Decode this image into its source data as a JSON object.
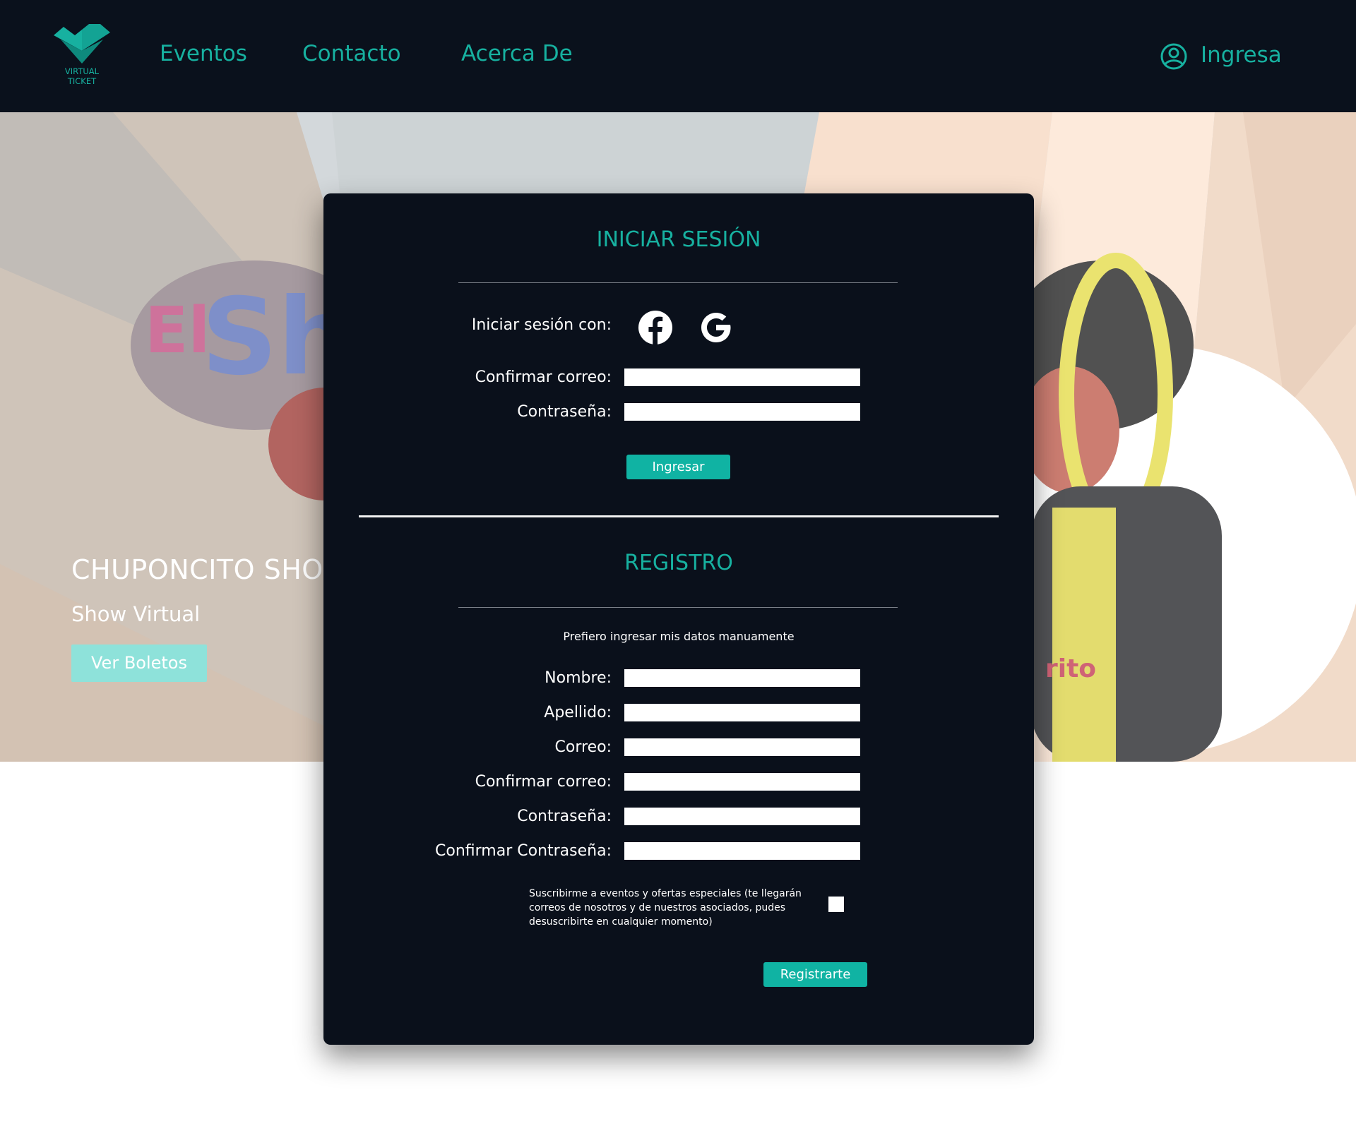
{
  "navbar": {
    "logo_text_1": "VIRTUAL",
    "logo_text_2": "TICKET",
    "links": [
      "Eventos",
      "Contacto",
      "Acerca De"
    ],
    "login_label": "Ingresa",
    "icons": {
      "user": "user-circle-icon",
      "logo": "virtual-ticket-logo"
    }
  },
  "hero": {
    "title": "CHUPONCITO SHOW",
    "subtitle": "Show Virtual",
    "button_label": "Ver Boletos"
  },
  "login": {
    "title": "INICIAR SESIÓN",
    "social_label": "Iniciar sesión con:",
    "social_icons": [
      "facebook-icon",
      "google-icon"
    ],
    "email_label": "Confirmar correo:",
    "password_label": "Contraseña:",
    "submit_label": "Ingresar"
  },
  "register": {
    "title": "REGISTRO",
    "manual_text": "Prefiero ingresar mis datos manuamente",
    "fields": [
      "Nombre:",
      "Apellido:",
      "Correo:",
      "Confirmar correo:",
      "Contraseña:",
      "Confirmar Contraseña:"
    ],
    "subscribe_text": "Suscribirme a eventos y ofertas especiales (te llegarán correos de nosotros y de nuestros asociados, pudes desuscribirte en cualquier momento)",
    "subscribe_checked": false,
    "submit_label": "Registrarte"
  },
  "colors": {
    "navbar_bg": "#0a111c",
    "accent": "#17b1a0",
    "button": "#10b3a3",
    "modal_bg": "#0a101b",
    "hero_button": "#8ee2da"
  }
}
